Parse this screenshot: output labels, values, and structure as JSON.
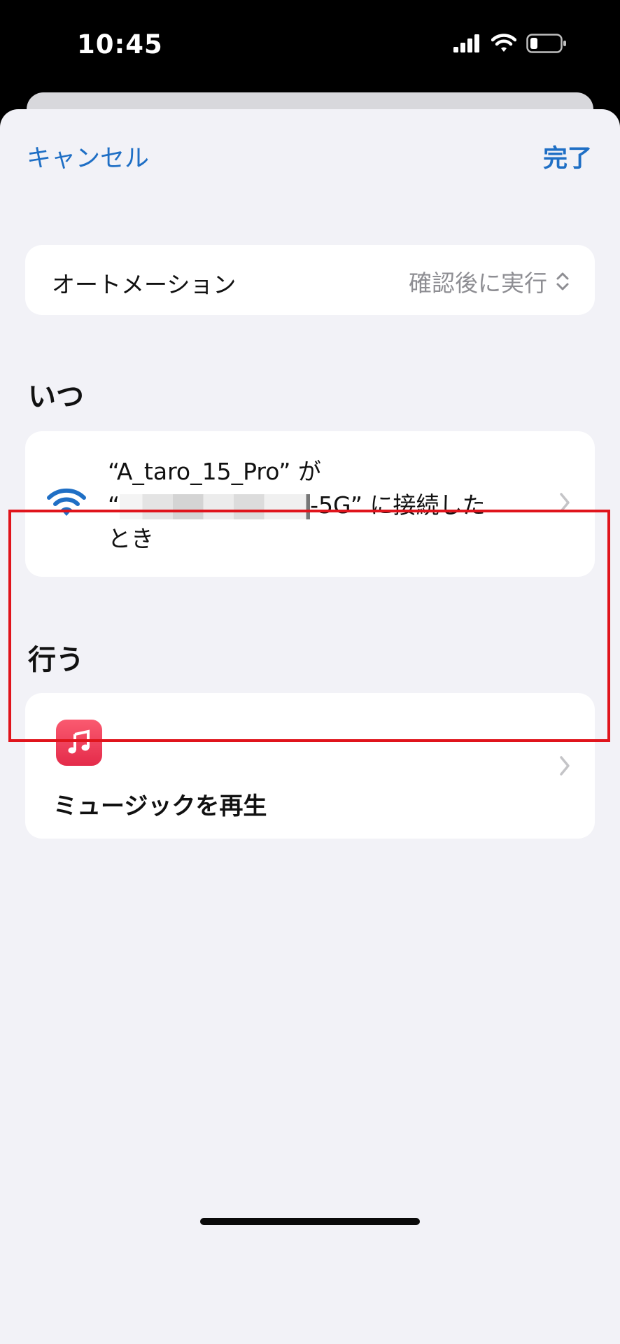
{
  "status_bar": {
    "time": "10:45"
  },
  "nav": {
    "cancel_label": "キャンセル",
    "done_label": "完了"
  },
  "automation": {
    "label": "オートメーション",
    "value": "確認後に実行"
  },
  "when": {
    "title": "いつ",
    "line1": "“A_taro_15_Pro” が",
    "line2_prefix": "“",
    "line2_suffix": "-5G” に接続した",
    "line3": "とき"
  },
  "do": {
    "title": "行う",
    "action_label": "ミュージックを再生"
  },
  "colors": {
    "accent": "#1f6fc5",
    "highlight": "#e0141c",
    "music_icon": "#f0435c"
  }
}
